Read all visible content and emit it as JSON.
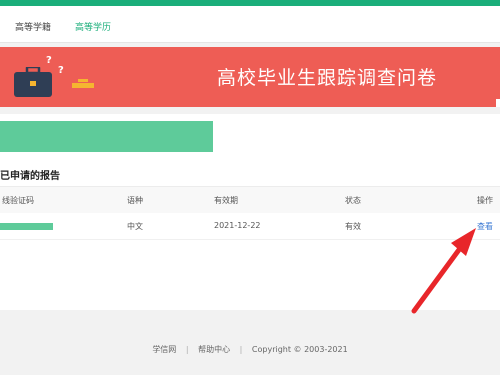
{
  "tabs": [
    {
      "label": "高等学籍",
      "active": false
    },
    {
      "label": "高等学历",
      "active": true
    }
  ],
  "banner": {
    "title": "高校毕业生跟踪调查问卷",
    "question_mark": "?",
    "color": "#ee5d55"
  },
  "reports": {
    "section_title": "已申请的报告",
    "columns": [
      "线验证码",
      "语种",
      "有效期",
      "状态",
      "操作"
    ],
    "rows": [
      {
        "language": "中文",
        "validity": "2021-12-22",
        "status": "有效",
        "action": "查看"
      }
    ]
  },
  "footer": {
    "links": [
      "学信网",
      "帮助中心"
    ],
    "separator": "|",
    "copyright": "Copyright © 2003-2021"
  },
  "colors": {
    "brand_green": "#1aae7a",
    "mask_green": "#5ecb9a",
    "link_blue": "#3a79d4",
    "annotation_arrow": "#e8262a"
  }
}
